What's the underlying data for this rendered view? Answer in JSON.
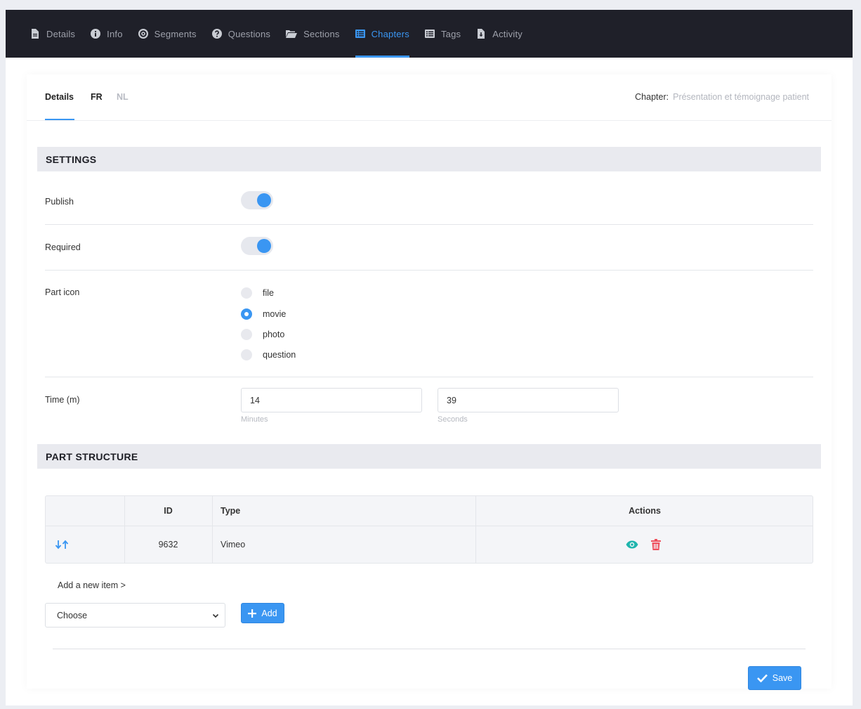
{
  "topnav": {
    "tabs": [
      {
        "label": "Details",
        "icon": "file-icon"
      },
      {
        "label": "Info",
        "icon": "info-icon"
      },
      {
        "label": "Segments",
        "icon": "target-icon"
      },
      {
        "label": "Questions",
        "icon": "question-icon"
      },
      {
        "label": "Sections",
        "icon": "folder-open-icon"
      },
      {
        "label": "Chapters",
        "icon": "list-alt-icon",
        "active": true
      },
      {
        "label": "Tags",
        "icon": "list-icon"
      },
      {
        "label": "Activity",
        "icon": "file-download-icon"
      }
    ]
  },
  "subnav": {
    "tabs": [
      "Details",
      "FR",
      "NL"
    ],
    "active": "Details",
    "chapter_label": "Chapter:",
    "chapter_value": "Présentation et témoignage patient"
  },
  "settings": {
    "title": "SETTINGS",
    "publish_label": "Publish",
    "publish_on": true,
    "required_label": "Required",
    "required_on": true,
    "part_icon_label": "Part icon",
    "part_icon_options": [
      "file",
      "movie",
      "photo",
      "question"
    ],
    "part_icon_selected": "movie",
    "time_label": "Time (m)",
    "minutes_value": "14",
    "minutes_hint": "Minutes",
    "seconds_value": "39",
    "seconds_hint": "Seconds"
  },
  "structure": {
    "title": "PART STRUCTURE",
    "columns": [
      "",
      "ID",
      "Type",
      "Actions"
    ],
    "rows": [
      {
        "id": "9632",
        "type": "Vimeo"
      }
    ],
    "add_link": "Add a new item >",
    "select_value": "Choose",
    "add_button": "Add"
  },
  "footer": {
    "save_label": "Save"
  },
  "colors": {
    "accent": "#3a96f2",
    "nav_bg": "#1f2029",
    "view_icon": "#1fb5ad",
    "delete_icon": "#ee4e5c"
  }
}
